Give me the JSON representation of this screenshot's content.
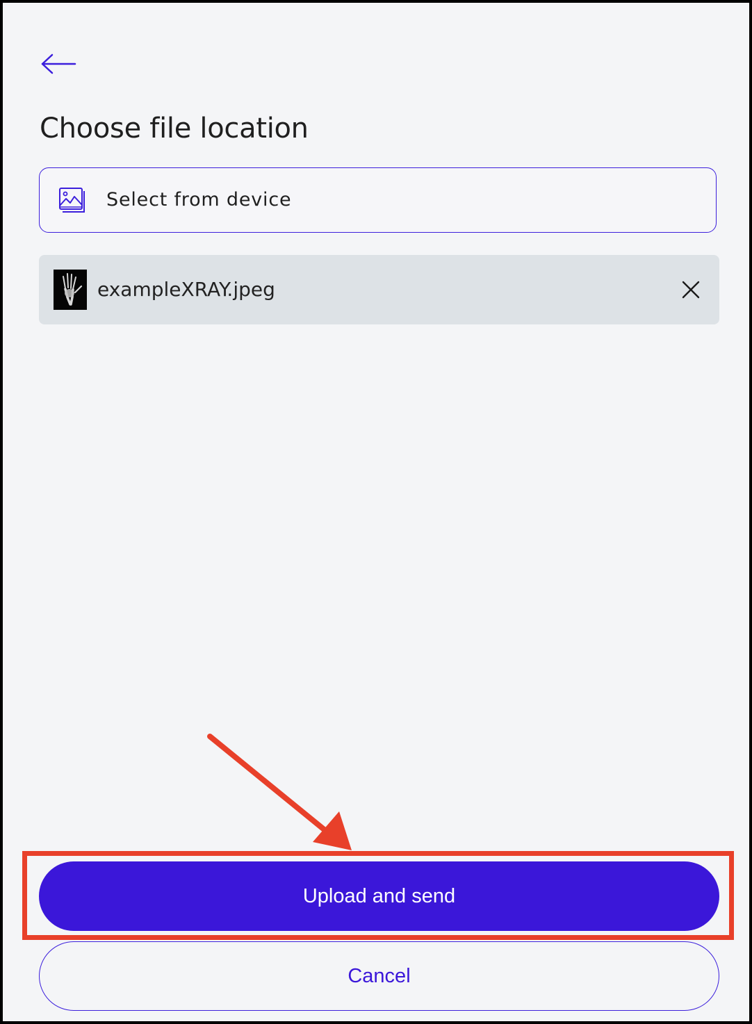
{
  "header": {
    "back_icon": "arrow-left-icon",
    "title": "Choose file location"
  },
  "source": {
    "icon": "image-gallery-icon",
    "label": "Select from device"
  },
  "attachment": {
    "thumbnail": "xray-thumbnail",
    "file_name": "exampleXRAY.jpeg",
    "remove_icon": "close-icon"
  },
  "actions": {
    "primary_label": "Upload and send",
    "secondary_label": "Cancel"
  },
  "colors": {
    "accent": "#3b17d9",
    "background": "#f4f5f7",
    "file_row": "#dde2e6",
    "annotation": "#e8402a"
  }
}
